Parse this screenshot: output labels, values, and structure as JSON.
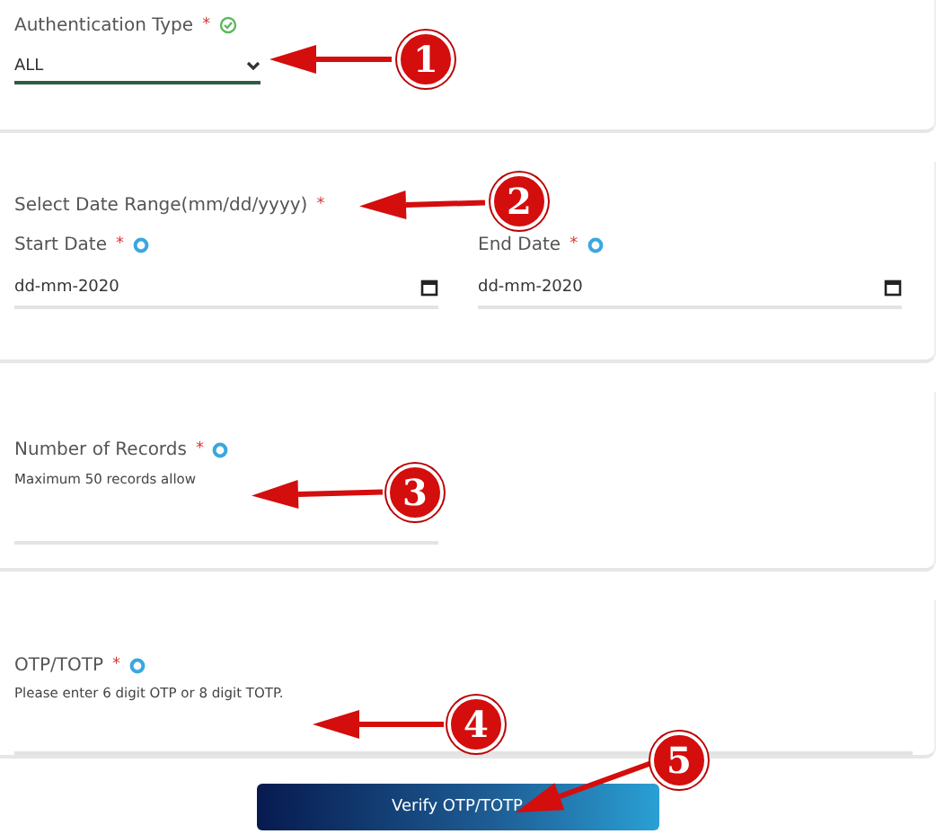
{
  "authentication": {
    "label": "Authentication Type",
    "required_mark": "*",
    "select": {
      "value": "ALL"
    }
  },
  "date_range": {
    "label": "Select Date Range(mm/dd/yyyy)",
    "required_mark": "*",
    "fields": [
      {
        "label": "Start Date",
        "required_mark": "*",
        "value": "dd-mm-2020"
      },
      {
        "label": "End Date",
        "required_mark": "*",
        "value": "dd-mm-2020"
      }
    ]
  },
  "records": {
    "label": "Number of Records",
    "required_mark": "*",
    "hint": "Maximum 50 records allow"
  },
  "otp": {
    "label": "OTP/TOTP",
    "required_mark": "*",
    "hint": "Please enter 6 digit OTP or 8 digit TOTP."
  },
  "button": {
    "label": "Verify OTP/TOTP"
  },
  "annotations": [
    "1",
    "2",
    "3",
    "4",
    "5"
  ]
}
